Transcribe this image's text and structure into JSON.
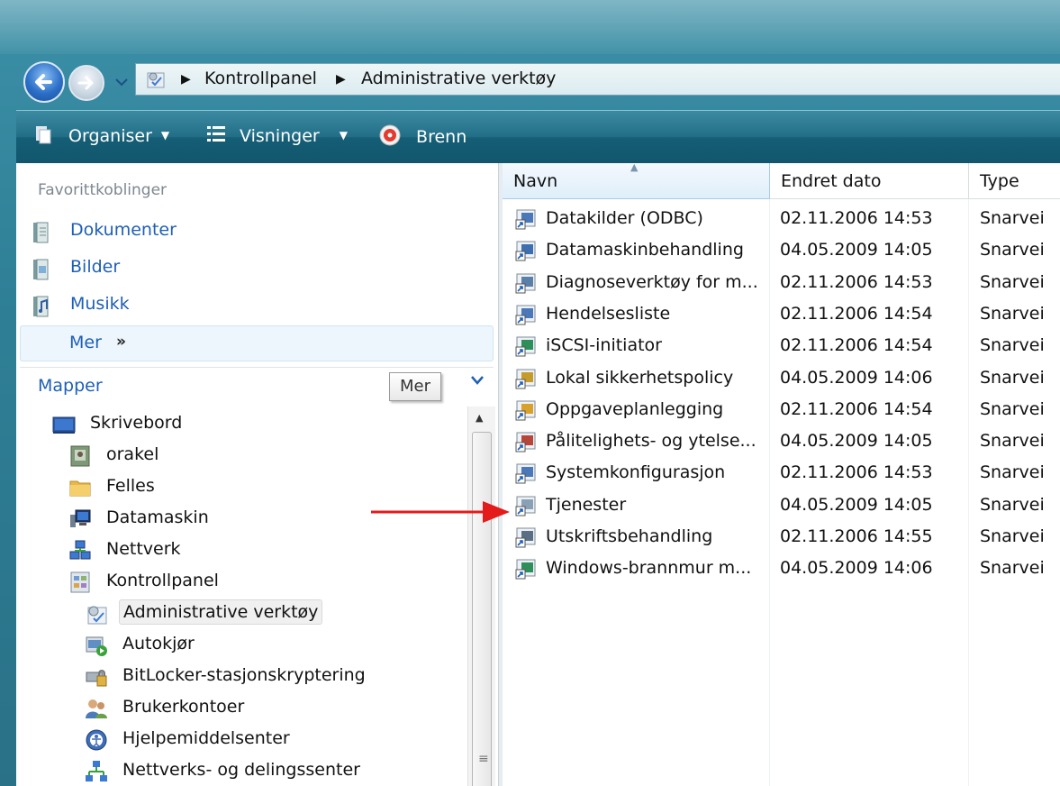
{
  "address": {
    "crumbs": [
      "Kontrollpanel",
      "Administrative verktøy"
    ]
  },
  "toolbar": {
    "organise_label": "Organiser",
    "views_label": "Visninger",
    "burn_label": "Brenn"
  },
  "sidebar": {
    "favorites_title": "Favorittkoblinger",
    "favorites": [
      {
        "label": "Dokumenter",
        "icon": "documents-icon"
      },
      {
        "label": "Bilder",
        "icon": "pictures-icon"
      },
      {
        "label": "Musikk",
        "icon": "music-icon"
      }
    ],
    "more_label": "Mer",
    "more_chevron": "»",
    "folders_title": "Mapper",
    "more_tooltip": "Mer",
    "tree": [
      {
        "label": "Skrivebord",
        "icon": "desktop-icon",
        "level": 0
      },
      {
        "label": "orakel",
        "icon": "user-folder-icon",
        "level": 1
      },
      {
        "label": "Felles",
        "icon": "folder-icon",
        "level": 1
      },
      {
        "label": "Datamaskin",
        "icon": "computer-icon",
        "level": 1
      },
      {
        "label": "Nettverk",
        "icon": "network-icon",
        "level": 1
      },
      {
        "label": "Kontrollpanel",
        "icon": "control-panel-icon",
        "level": 1
      },
      {
        "label": "Administrative verktøy",
        "icon": "admin-tools-icon",
        "level": 2,
        "selected": true
      },
      {
        "label": "Autokjør",
        "icon": "autoplay-icon",
        "level": 2
      },
      {
        "label": "BitLocker-stasjonskryptering",
        "icon": "bitlocker-icon",
        "level": 2
      },
      {
        "label": "Brukerkontoer",
        "icon": "user-accounts-icon",
        "level": 2
      },
      {
        "label": "Hjelpemiddelsenter",
        "icon": "ease-of-access-icon",
        "level": 2
      },
      {
        "label": "Nettverks- og delingssenter",
        "icon": "network-sharing-icon",
        "level": 2
      }
    ]
  },
  "file_list": {
    "columns": [
      "Navn",
      "Endret dato",
      "Type"
    ],
    "sorted_column": "Navn",
    "rows": [
      {
        "name": "Datakilder (ODBC)",
        "date": "02.11.2006 14:53",
        "type": "Snarvei",
        "icon": "odbc-shortcut-icon"
      },
      {
        "name": "Datamaskinbehandling",
        "date": "04.05.2009 14:05",
        "type": "Snarvei",
        "icon": "computer-management-shortcut-icon"
      },
      {
        "name": "Diagnoseverktøy for m...",
        "date": "02.11.2006 14:53",
        "type": "Snarvei",
        "icon": "diagnostics-shortcut-icon"
      },
      {
        "name": "Hendelsesliste",
        "date": "02.11.2006 14:54",
        "type": "Snarvei",
        "icon": "event-viewer-shortcut-icon"
      },
      {
        "name": "iSCSI-initiator",
        "date": "02.11.2006 14:54",
        "type": "Snarvei",
        "icon": "iscsi-shortcut-icon"
      },
      {
        "name": "Lokal sikkerhetspolicy",
        "date": "04.05.2009 14:06",
        "type": "Snarvei",
        "icon": "security-policy-shortcut-icon"
      },
      {
        "name": "Oppgaveplanlegging",
        "date": "02.11.2006 14:54",
        "type": "Snarvei",
        "icon": "task-scheduler-shortcut-icon"
      },
      {
        "name": "Pålitelighets- og ytelse...",
        "date": "04.05.2009 14:05",
        "type": "Snarvei",
        "icon": "reliability-shortcut-icon"
      },
      {
        "name": "Systemkonfigurasjon",
        "date": "02.11.2006 14:53",
        "type": "Snarvei",
        "icon": "msconfig-shortcut-icon"
      },
      {
        "name": "Tjenester",
        "date": "04.05.2009 14:05",
        "type": "Snarvei",
        "icon": "services-shortcut-icon"
      },
      {
        "name": "Utskriftsbehandling",
        "date": "02.11.2006 14:55",
        "type": "Snarvei",
        "icon": "print-management-shortcut-icon"
      },
      {
        "name": "Windows-brannmur m...",
        "date": "04.05.2009 14:06",
        "type": "Snarvei",
        "icon": "firewall-shortcut-icon"
      }
    ]
  },
  "colors": {
    "link_blue": "#1e5fb6",
    "toolbar_teal": "#226e87",
    "annotation_arrow": "#e31b1b"
  }
}
